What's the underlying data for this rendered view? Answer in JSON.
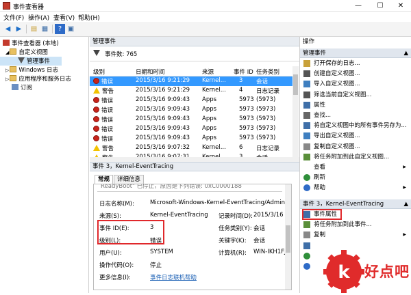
{
  "window": {
    "title": "事件查看器",
    "minimize": "—",
    "maximize": "☐",
    "close": "✕"
  },
  "menu": [
    "文件(F)",
    "操作(A)",
    "查看(V)",
    "帮助(H)"
  ],
  "tree": [
    {
      "label": "事件查看器 (本地)",
      "indent": 0,
      "icon": "computer-icon"
    },
    {
      "label": "自定义视图",
      "indent": 1,
      "icon": "folder-icon"
    },
    {
      "label": "管理事件",
      "indent": 2,
      "icon": "filter-icon",
      "selected": true
    },
    {
      "label": "Windows 日志",
      "indent": 1,
      "icon": "folder-icon"
    },
    {
      "label": "应用程序和服务日志",
      "indent": 1,
      "icon": "folder-icon"
    },
    {
      "label": "订阅",
      "indent": 1,
      "icon": "subscription-icon"
    }
  ],
  "center": {
    "header": "管理事件",
    "event_count_label": "事件数: 765",
    "columns": [
      "级别",
      "日期和时间",
      "来源",
      "事件 ID",
      "任务类别"
    ],
    "rows": [
      {
        "level": "错误",
        "type": "err",
        "datetime": "2015/3/16 9:21:29",
        "source": "Kernel...",
        "id": "3",
        "task": "会话",
        "selected": true
      },
      {
        "level": "警告",
        "type": "warn",
        "datetime": "2015/3/16 9:21:29",
        "source": "Kernel...",
        "id": "4",
        "task": "日志记录"
      },
      {
        "level": "错误",
        "type": "err",
        "datetime": "2015/3/16 9:09:43",
        "source": "Apps",
        "id": "5973",
        "task": "(5973)"
      },
      {
        "level": "错误",
        "type": "err",
        "datetime": "2015/3/16 9:09:43",
        "source": "Apps",
        "id": "5973",
        "task": "(5973)"
      },
      {
        "level": "错误",
        "type": "err",
        "datetime": "2015/3/16 9:09:43",
        "source": "Apps",
        "id": "5973",
        "task": "(5973)"
      },
      {
        "level": "错误",
        "type": "err",
        "datetime": "2015/3/16 9:09:43",
        "source": "Apps",
        "id": "5973",
        "task": "(5973)"
      },
      {
        "level": "错误",
        "type": "err",
        "datetime": "2015/3/16 9:09:43",
        "source": "Apps",
        "id": "5973",
        "task": "(5973)"
      },
      {
        "level": "警告",
        "type": "warn",
        "datetime": "2015/3/16 9:07:32",
        "source": "Kernel...",
        "id": "6",
        "task": "日志记录"
      },
      {
        "level": "警告",
        "type": "warn",
        "datetime": "2015/3/16 9:07:31",
        "source": "Kernel...",
        "id": "3",
        "task": "会话"
      }
    ]
  },
  "detail": {
    "header": "事件 3，Kernel-EventTracing",
    "tabs": [
      "常规",
      "详细信息"
    ],
    "top_text": "ReadyBoot\" 已停止，原因是下列错误: 0xC0000188",
    "log_name_label": "日志名称(M):",
    "log_name": "Microsoft-Windows-Kernel-EventTracing/Admin",
    "source_label": "来源(S):",
    "source": "Kernel-EventTracing",
    "logged_label": "记录时间(D):",
    "logged": "2015/3/16 9:21:29",
    "event_id_label": "事件 ID(E):",
    "event_id": "3",
    "task_label": "任务类别(Y):",
    "task": "会话",
    "level_label": "级别(L):",
    "level": "错误",
    "keywords_label": "关键字(K):",
    "keywords": "会话",
    "user_label": "用户(U):",
    "user": "SYSTEM",
    "computer_label": "计算机(R):",
    "computer": "WIN-IKH1FJ",
    "opcode_label": "操作代码(O):",
    "opcode": "停止",
    "more_info_label": "更多信息(I):",
    "more_info_link": "事件日志联机帮助"
  },
  "actions": {
    "header": "操作",
    "section1": "管理事件",
    "items1": [
      {
        "label": "打开保存的日志...",
        "icon": "open-log-icon"
      },
      {
        "label": "创建自定义视图...",
        "icon": "filter-icon"
      },
      {
        "label": "导入自定义视图...",
        "icon": "import-icon"
      },
      {
        "label": "筛选当前自定义视图...",
        "icon": "filter-icon"
      },
      {
        "label": "属性",
        "icon": "properties-icon"
      },
      {
        "label": "查找...",
        "icon": "find-icon"
      },
      {
        "label": "将自定义视图中的所有事件另存为...",
        "icon": "save-icon"
      },
      {
        "label": "导出自定义视图...",
        "icon": "export-icon"
      },
      {
        "label": "复制自定义视图...",
        "icon": "copy-icon"
      },
      {
        "label": "将任务附加到此自定义视图...",
        "icon": "task-icon"
      },
      {
        "label": "查看",
        "icon": "none",
        "submenu": true
      },
      {
        "label": "刷新",
        "icon": "refresh-icon"
      },
      {
        "label": "帮助",
        "icon": "help-icon",
        "submenu": true
      }
    ],
    "section2": "事件 3，Kernel-EventTracing",
    "items2": [
      {
        "label": "事件属性",
        "icon": "properties-icon",
        "highlighted": true
      },
      {
        "label": "将任务附加到此事件...",
        "icon": "task-icon"
      },
      {
        "label": "复制",
        "icon": "copy-icon",
        "submenu": true
      },
      {
        "label": "",
        "icon": "save-icon"
      },
      {
        "label": "",
        "icon": "refresh-icon"
      },
      {
        "label": "",
        "icon": "help-icon"
      }
    ]
  },
  "watermark": {
    "text": "好点吧",
    "color": "#e02b2b"
  }
}
